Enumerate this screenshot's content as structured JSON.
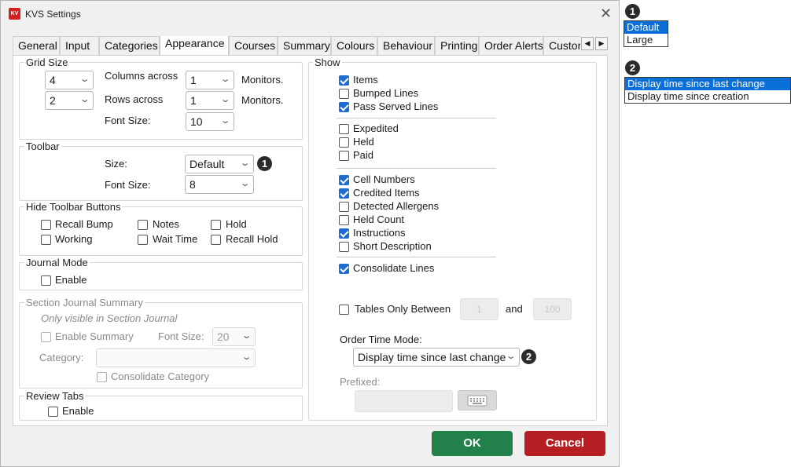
{
  "window": {
    "title": "KVS Settings",
    "app_icon_text": "KV"
  },
  "tabs": [
    "General",
    "Input",
    "Categories",
    "Appearance",
    "Courses",
    "Summary",
    "Colours",
    "Behaviour",
    "Printing",
    "Order Alerts",
    "Custor"
  ],
  "grid_size": {
    "title": "Grid Size",
    "columns_value": "4",
    "columns_label": "Columns across",
    "columns_monitors": "1",
    "monitors_label": "Monitors.",
    "rows_value": "2",
    "rows_label": "Rows across",
    "rows_monitors": "1",
    "font_size_label": "Font Size:",
    "font_size_value": "10"
  },
  "toolbar": {
    "title": "Toolbar",
    "size_label": "Size:",
    "size_value": "Default",
    "font_size_label": "Font Size:",
    "font_size_value": "8"
  },
  "hide_toolbar_buttons": {
    "title": "Hide Toolbar Buttons",
    "items": [
      "Recall Bump",
      "Notes",
      "Hold",
      "Working",
      "Wait Time",
      "Recall Hold"
    ]
  },
  "journal_mode": {
    "title": "Journal Mode",
    "enable": "Enable"
  },
  "section_journal": {
    "title": "Section Journal Summary",
    "note": "Only visible in Section Journal",
    "enable_summary": "Enable Summary",
    "font_size_label": "Font Size:",
    "font_size_value": "20",
    "category_label": "Category:",
    "consolidate": "Consolidate Category"
  },
  "review_tabs": {
    "title": "Review Tabs",
    "enable": "Enable"
  },
  "show": {
    "title": "Show",
    "items": [
      {
        "label": "Items",
        "checked": true
      },
      {
        "label": "Bumped Lines",
        "checked": false
      },
      {
        "label": "Pass Served Lines",
        "checked": true
      },
      {
        "label": "Expedited",
        "checked": false
      },
      {
        "label": "Held",
        "checked": false
      },
      {
        "label": "Paid",
        "checked": false
      },
      {
        "label": "Cell Numbers",
        "checked": true
      },
      {
        "label": "Credited Items",
        "checked": true
      },
      {
        "label": "Detected Allergens",
        "checked": false
      },
      {
        "label": "Held Count",
        "checked": false
      },
      {
        "label": "Instructions",
        "checked": true
      },
      {
        "label": "Short Description",
        "checked": false
      },
      {
        "label": "Consolidate Lines",
        "checked": true
      }
    ]
  },
  "tables_only": {
    "label": "Tables Only Between",
    "from": "1",
    "and_label": "and",
    "to": "100"
  },
  "order_time": {
    "label": "Order Time Mode:",
    "value": "Display time since last change",
    "prefixed_label": "Prefixed:"
  },
  "buttons": {
    "ok": "OK",
    "cancel": "Cancel"
  },
  "callouts": {
    "one": "1",
    "two": "2"
  },
  "dropdown1": {
    "options": [
      "Default",
      "Large"
    ],
    "selected": "Default"
  },
  "dropdown2": {
    "options": [
      "Display time since last change",
      "Display time since creation"
    ],
    "selected": "Display time since last change"
  },
  "colors": {
    "ok": "#22804a",
    "cancel": "#b51f24",
    "checkbox": "#1c6cd1",
    "highlight": "#0a6fd8"
  }
}
